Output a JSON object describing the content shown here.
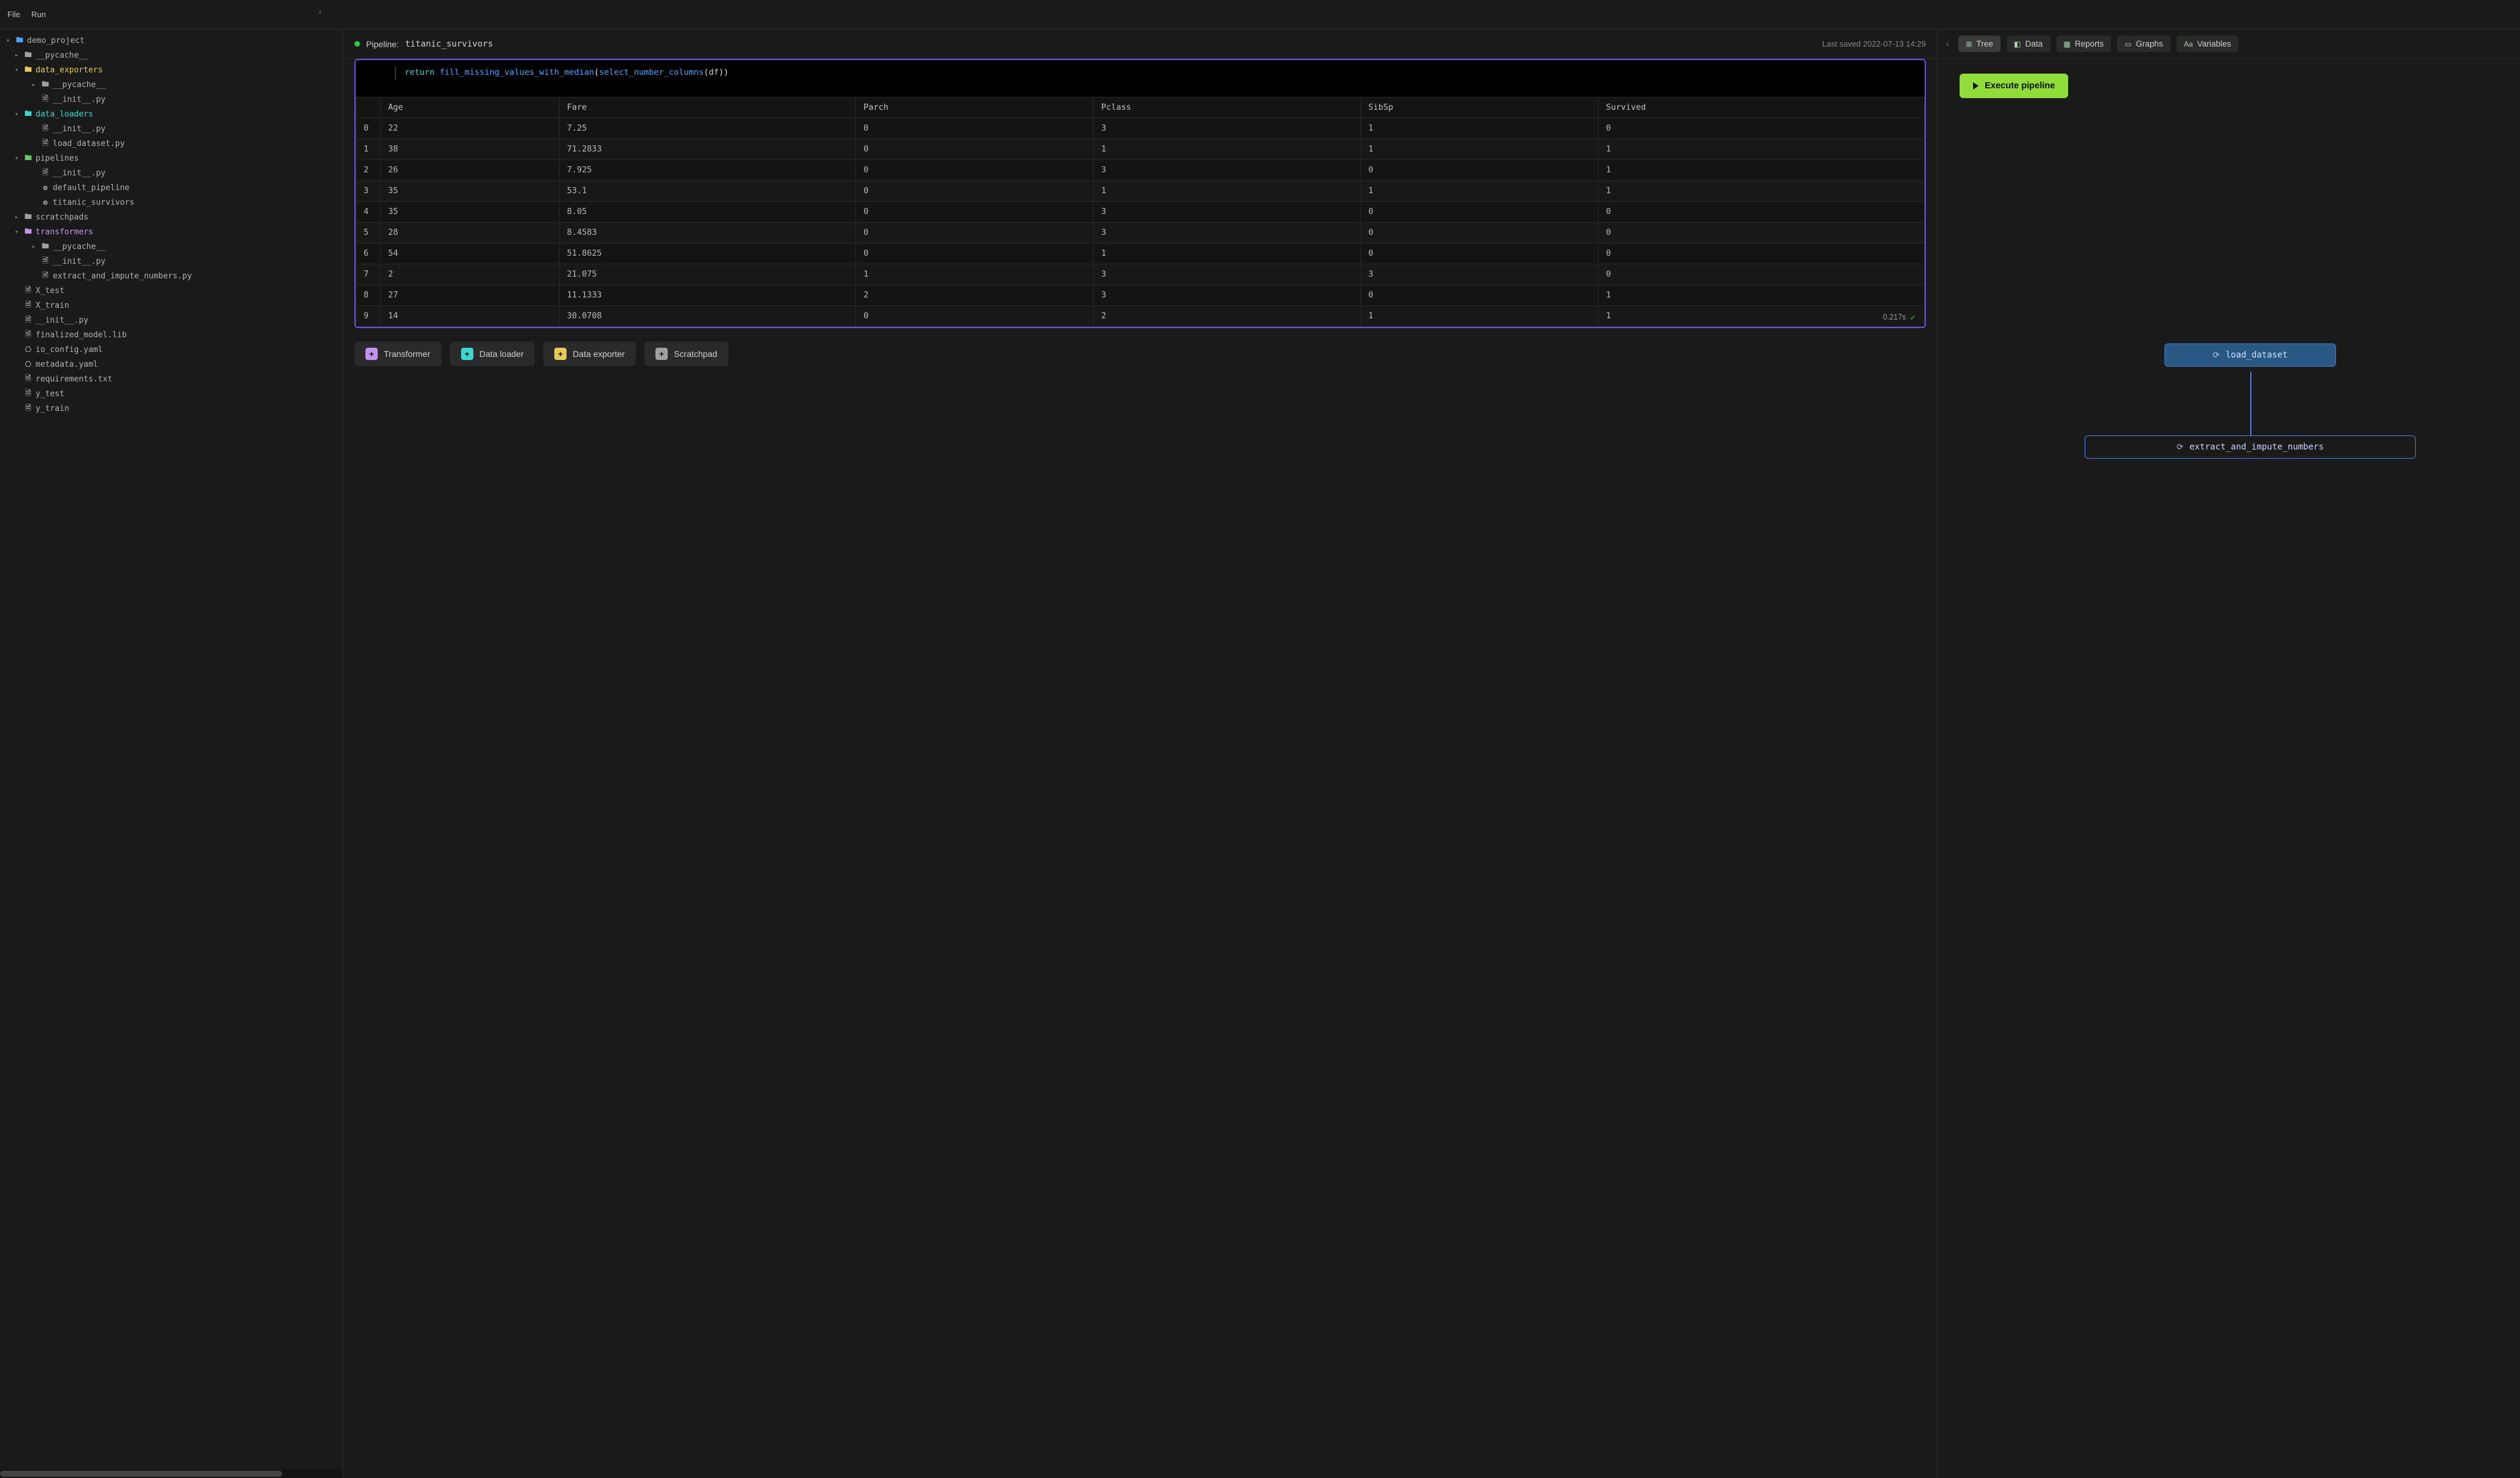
{
  "menu": {
    "file": "File",
    "run": "Run"
  },
  "sidebar_collapse_icon": "‹",
  "filetree": [
    {
      "indent": 0,
      "chev": "▾",
      "icon": "folder",
      "color": "folder-blue",
      "label": "demo_project",
      "labelClass": "text-gray"
    },
    {
      "indent": 1,
      "chev": "▸",
      "icon": "folder",
      "color": "folder-gray",
      "label": "__pycache__",
      "labelClass": "text-gray"
    },
    {
      "indent": 1,
      "chev": "▾",
      "icon": "folder",
      "color": "folder-yellow",
      "label": "data_exporters",
      "labelClass": "text-yellow"
    },
    {
      "indent": 2,
      "chev": "▸",
      "icon": "folder",
      "color": "folder-gray",
      "label": "__pycache__",
      "labelClass": "text-gray"
    },
    {
      "indent": 2,
      "chev": "",
      "icon": "file",
      "color": "folder-white",
      "label": "__init__.py",
      "labelClass": "text-gray"
    },
    {
      "indent": 1,
      "chev": "▾",
      "icon": "folder",
      "color": "folder-cyan",
      "label": "data_loaders",
      "labelClass": "text-cyan"
    },
    {
      "indent": 2,
      "chev": "",
      "icon": "file",
      "color": "folder-white",
      "label": "__init__.py",
      "labelClass": "text-gray"
    },
    {
      "indent": 2,
      "chev": "",
      "icon": "file",
      "color": "folder-white",
      "label": "load_dataset.py",
      "labelClass": "text-gray"
    },
    {
      "indent": 1,
      "chev": "▾",
      "icon": "folder",
      "color": "folder-green",
      "label": "pipelines",
      "labelClass": "text-gray"
    },
    {
      "indent": 2,
      "chev": "",
      "icon": "file",
      "color": "folder-white",
      "label": "__init__.py",
      "labelClass": "text-gray"
    },
    {
      "indent": 2,
      "chev": "",
      "icon": "gear",
      "color": "folder-white",
      "label": "default_pipeline",
      "labelClass": "text-gray"
    },
    {
      "indent": 2,
      "chev": "",
      "icon": "gear",
      "color": "folder-white",
      "label": "titanic_survivors",
      "labelClass": "text-gray"
    },
    {
      "indent": 1,
      "chev": "▸",
      "icon": "folder",
      "color": "folder-gray",
      "label": "scratchpads",
      "labelClass": "text-gray"
    },
    {
      "indent": 1,
      "chev": "▾",
      "icon": "folder",
      "color": "folder-purple",
      "label": "transformers",
      "labelClass": "text-purple"
    },
    {
      "indent": 2,
      "chev": "▸",
      "icon": "folder",
      "color": "folder-gray",
      "label": "__pycache__",
      "labelClass": "text-gray"
    },
    {
      "indent": 2,
      "chev": "",
      "icon": "file",
      "color": "folder-white",
      "label": "__init__.py",
      "labelClass": "text-gray"
    },
    {
      "indent": 2,
      "chev": "",
      "icon": "file",
      "color": "folder-white",
      "label": "extract_and_impute_numbers.py",
      "labelClass": "text-gray"
    },
    {
      "indent": 1,
      "chev": "",
      "icon": "file",
      "color": "folder-white",
      "label": "X_test",
      "labelClass": "text-gray"
    },
    {
      "indent": 1,
      "chev": "",
      "icon": "file",
      "color": "folder-white",
      "label": "X_train",
      "labelClass": "text-gray"
    },
    {
      "indent": 1,
      "chev": "",
      "icon": "file",
      "color": "folder-white",
      "label": "__init__.py",
      "labelClass": "text-gray"
    },
    {
      "indent": 1,
      "chev": "",
      "icon": "file",
      "color": "folder-white",
      "label": "finalized_model.lib",
      "labelClass": "text-gray"
    },
    {
      "indent": 1,
      "chev": "",
      "icon": "yaml",
      "color": "folder-white",
      "label": "io_config.yaml",
      "labelClass": "text-gray"
    },
    {
      "indent": 1,
      "chev": "",
      "icon": "yaml",
      "color": "folder-white",
      "label": "metadata.yaml",
      "labelClass": "text-gray"
    },
    {
      "indent": 1,
      "chev": "",
      "icon": "file",
      "color": "folder-white",
      "label": "requirements.txt",
      "labelClass": "text-gray"
    },
    {
      "indent": 1,
      "chev": "",
      "icon": "file",
      "color": "folder-white",
      "label": "y_test",
      "labelClass": "text-gray"
    },
    {
      "indent": 1,
      "chev": "",
      "icon": "file",
      "color": "folder-white",
      "label": "y_train",
      "labelClass": "text-gray"
    }
  ],
  "center": {
    "pipeline_prefix": "Pipeline:",
    "pipeline_name": "titanic_survivors",
    "last_saved": "Last saved 2022-07-13 14:29",
    "code": {
      "kw": "return",
      "fn1": "fill_missing_values_with_median",
      "fn2": "select_number_columns",
      "arg": "df"
    },
    "exec_time": "0.217s"
  },
  "table": {
    "columns": [
      "",
      "Age",
      "Fare",
      "Parch",
      "Pclass",
      "SibSp",
      "Survived"
    ],
    "rows": [
      [
        "0",
        "22",
        "7.25",
        "0",
        "3",
        "1",
        "0"
      ],
      [
        "1",
        "38",
        "71.2833",
        "0",
        "1",
        "1",
        "1"
      ],
      [
        "2",
        "26",
        "7.925",
        "0",
        "3",
        "0",
        "1"
      ],
      [
        "3",
        "35",
        "53.1",
        "0",
        "1",
        "1",
        "1"
      ],
      [
        "4",
        "35",
        "8.05",
        "0",
        "3",
        "0",
        "0"
      ],
      [
        "5",
        "28",
        "8.4583",
        "0",
        "3",
        "0",
        "0"
      ],
      [
        "6",
        "54",
        "51.8625",
        "0",
        "1",
        "0",
        "0"
      ],
      [
        "7",
        "2",
        "21.075",
        "1",
        "3",
        "3",
        "0"
      ],
      [
        "8",
        "27",
        "11.1333",
        "2",
        "3",
        "0",
        "1"
      ],
      [
        "9",
        "14",
        "30.0708",
        "0",
        "2",
        "1",
        "1"
      ]
    ]
  },
  "block_buttons": {
    "transformer": "Transformer",
    "data_loader": "Data loader",
    "data_exporter": "Data exporter",
    "scratchpad": "Scratchpad"
  },
  "right": {
    "tree": "Tree",
    "data": "Data",
    "reports": "Reports",
    "graphs": "Graphs",
    "variables": "Variables",
    "execute": "Execute pipeline",
    "node_loader": "load_dataset",
    "node_transformer": "extract_and_impute_numbers"
  }
}
